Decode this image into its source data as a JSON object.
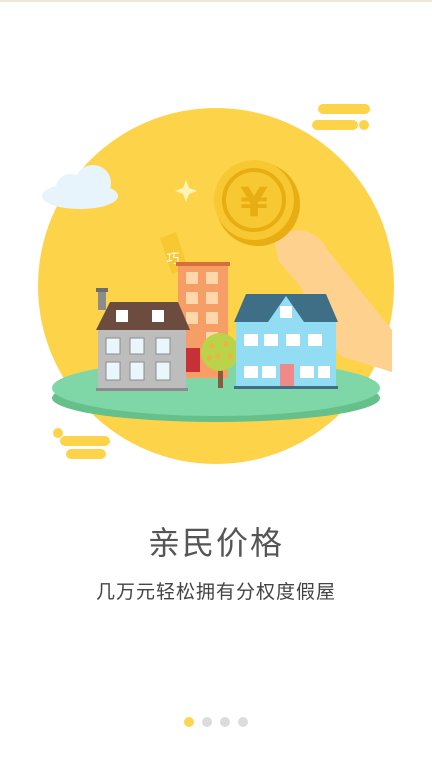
{
  "slide": {
    "title": "亲民价格",
    "subtitle": "几万元轻松拥有分权度假屋",
    "coin_symbol": "¥",
    "tag_text": "巧",
    "page_count": 4,
    "active_page": 1
  },
  "colors": {
    "sun": "#fdd449",
    "ground": "#7fd6a7",
    "ground_shadow": "#66c08c",
    "coin": "#f7c831",
    "coin_dark": "#e7ad12",
    "house_blue": "#92dcf4",
    "roof_blue": "#3f6e87",
    "roof_brown": "#6b4c3e",
    "tower_orange": "#f79e67",
    "hand": "#ffd18e",
    "cloud": "#e7f4fb",
    "dot_active": "#ffd54f",
    "dot_inactive": "#dcdcdc"
  },
  "icons": {
    "coin": "yuan-coin-icon",
    "cloud": "cloud-icon",
    "sparkle": "sparkle-icon",
    "tree": "tree-icon"
  }
}
